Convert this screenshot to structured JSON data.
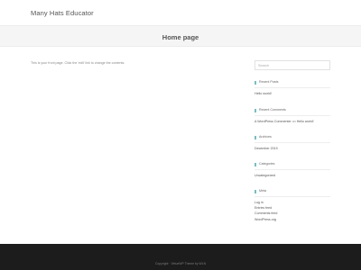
{
  "site": {
    "title": "Many Hats Educator"
  },
  "page": {
    "heading": "Home page",
    "content": "This is your front page. Click the 'edit' link to change the contents."
  },
  "sidebar": {
    "search": {
      "placeholder": "Search"
    },
    "recent_posts": {
      "title": "Recent Posts",
      "items": [
        "Hello world!"
      ]
    },
    "recent_comments": {
      "title": "Recent Comments",
      "author": "A WordPress Commenter",
      "connector": "on",
      "post": "Hello world!"
    },
    "archives": {
      "title": "Archives",
      "items": [
        "December 2019"
      ]
    },
    "categories": {
      "title": "Categories",
      "items": [
        "Uncategorized"
      ]
    },
    "meta": {
      "title": "Meta",
      "items": [
        "Log in",
        "Entries feed",
        "Comments feed",
        "WordPress.org"
      ]
    }
  },
  "footer": {
    "text": "Copyright · VirtueWP Theme by WLN"
  },
  "colors": {
    "accent": "#69c4c9",
    "footer_bg": "#1c1c1c",
    "banner_bg": "#f5f5f5"
  }
}
